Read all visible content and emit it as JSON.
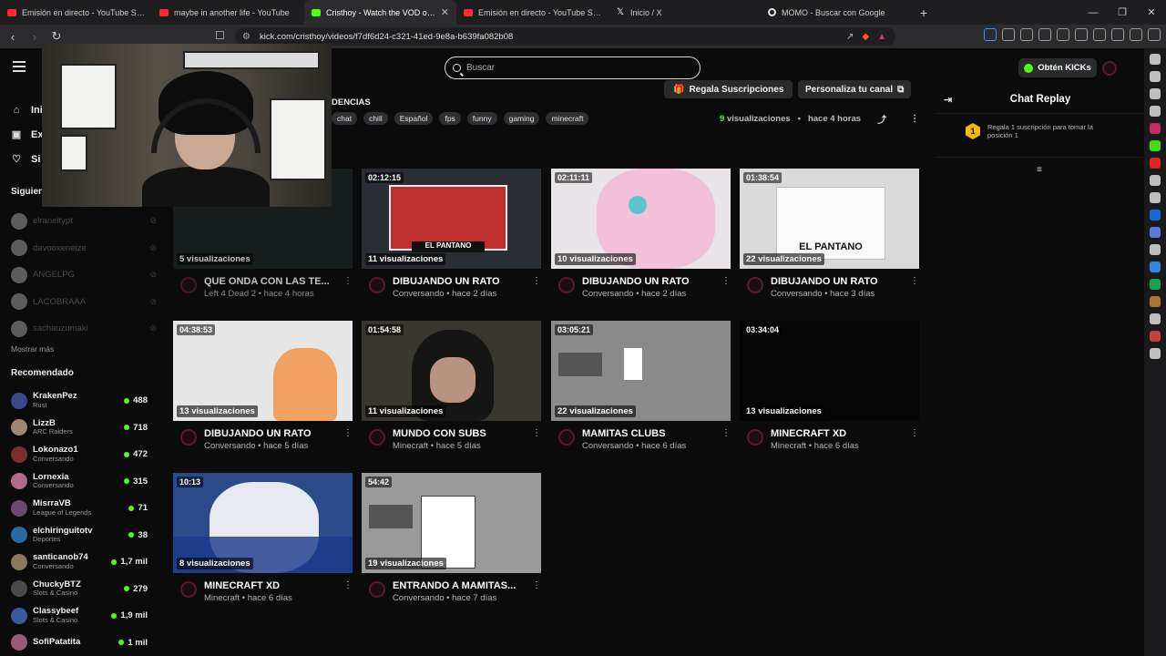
{
  "browser": {
    "tabs": [
      {
        "title": "Emisión en directo - YouTube Studio",
        "icon": "youtube-icon"
      },
      {
        "title": "maybe in another life - YouTube",
        "icon": "youtube-icon"
      },
      {
        "title": "Cristhoy - Watch the VOD on Kic",
        "icon": "kick-icon",
        "active": true
      },
      {
        "title": "Emisión en directo - YouTube Studio",
        "icon": "youtube-icon"
      },
      {
        "title": "Inicio / X",
        "icon": "x-icon"
      },
      {
        "title": "MOMO - Buscar con Google",
        "icon": "google-icon"
      }
    ],
    "url": "kick.com/cristhoy/videos/f7df6d24-c321-41ed-9e8a-b639fa082b08"
  },
  "sidebar": {
    "nav": [
      {
        "label": "Ini",
        "icon": "home-icon"
      },
      {
        "label": "Ex",
        "icon": "browse-icon"
      },
      {
        "label": "Si",
        "icon": "heart-icon"
      }
    ],
    "following_label": "Siguien",
    "following": [
      {
        "name": "elraneitypt"
      },
      {
        "name": "davooxeneize"
      },
      {
        "name": "ANGELPG"
      },
      {
        "name": "LACOBRAAA"
      },
      {
        "name": "sachauzumaki"
      }
    ],
    "show_more": "Mostrar más",
    "recommended_label": "Recomendado",
    "recommended": [
      {
        "name": "KrakenPez",
        "category": "Rust",
        "viewers": "488",
        "color": "#3b4a8a"
      },
      {
        "name": "LizzB",
        "category": "ARC Raiders",
        "viewers": "718",
        "color": "#a08770"
      },
      {
        "name": "Lokonazo1",
        "category": "Conversando",
        "viewers": "472",
        "color": "#7a2e2e"
      },
      {
        "name": "Lornexia",
        "category": "Conversando",
        "viewers": "315",
        "color": "#b06a8a"
      },
      {
        "name": "MisrraVB",
        "category": "League of Legends",
        "viewers": "71",
        "color": "#6a4a6a"
      },
      {
        "name": "elchiringuitotv",
        "category": "Deportes",
        "viewers": "38",
        "color": "#2a6aa0"
      },
      {
        "name": "santicanob74",
        "category": "Conversando",
        "viewers": "1,7 mil",
        "color": "#8a7a5a"
      },
      {
        "name": "ChuckyBTZ",
        "category": "Slots & Casino",
        "viewers": "279",
        "color": "#4a4a4a"
      },
      {
        "name": "Classybeef",
        "category": "Slots & Casino",
        "viewers": "1,9 mil",
        "color": "#3a5aa0"
      },
      {
        "name": "SofiPatatita",
        "category": "",
        "viewers": "1 mil",
        "color": "#9a5a7a"
      }
    ]
  },
  "header": {
    "search_placeholder": "Buscar",
    "kicks_label": "Obtén KICKs",
    "section_label": "DENCIAS",
    "gift_label": "Regala Suscripciones",
    "customize_label": "Personaliza tu canal",
    "tags": [
      "chat",
      "chill",
      "Español",
      "fps",
      "funny",
      "gaming",
      "minecraft"
    ],
    "views_count": "9",
    "views_label": "visualizaciones",
    "separator": "•",
    "ago": "hace 4 horas"
  },
  "videos": [
    {
      "duration": "",
      "views": "5 visualizaciones",
      "title": "QUE ONDA CON LAS TE...",
      "category": "Left 4 Dead 2",
      "ago": "hace 4 horas",
      "thumb": "#1c2422",
      "dim": true
    },
    {
      "duration": "02:12:15",
      "views": "11 visualizaciones",
      "title": "DIBUJANDO UN RATO",
      "category": "Conversando",
      "ago": "hace 2 días",
      "thumb": "#2a2d33"
    },
    {
      "duration": "02:11:11",
      "views": "10 visualizaciones",
      "title": "DIBUJANDO UN RATO",
      "category": "Conversando",
      "ago": "hace 2 días",
      "thumb": "#e8e4e8"
    },
    {
      "duration": "01:38:54",
      "views": "22 visualizaciones",
      "title": "DIBUJANDO UN RATO",
      "category": "Conversando",
      "ago": "hace 3 días",
      "thumb": "#d9d9d9"
    },
    {
      "duration": "04:38:53",
      "views": "13 visualizaciones",
      "title": "DIBUJANDO UN RATO",
      "category": "Conversando",
      "ago": "hace 5 días",
      "thumb": "#e6e6e6"
    },
    {
      "duration": "01:54:58",
      "views": "11 visualizaciones",
      "title": "MUNDO CON SUBS",
      "category": "Minecraft",
      "ago": "hace 5 días",
      "thumb": "#3a3630"
    },
    {
      "duration": "03:05:21",
      "views": "22 visualizaciones",
      "title": "MAMITAS CLUBS",
      "category": "Conversando",
      "ago": "hace 6 días",
      "thumb": "#8a8a8a"
    },
    {
      "duration": "03:34:04",
      "views": "13 visualizaciones",
      "title": "MINECRAFT XD",
      "category": "Minecraft",
      "ago": "hace 6 días",
      "thumb": "#050505"
    },
    {
      "duration": "10:13",
      "views": "8 visualizaciones",
      "title": "MINECRAFT XD",
      "category": "Minecraft",
      "ago": "hace 6 días",
      "thumb": "#2a4a8a"
    },
    {
      "duration": "54:42",
      "views": "19 visualizaciones",
      "title": "ENTRANDO A MAMITAS...",
      "category": "Conversando",
      "ago": "hace 7 días",
      "thumb": "#9a9a9a"
    }
  ],
  "chat": {
    "title": "Chat Replay",
    "goal_rank": "1",
    "goal_text": "Regala 1 suscripción para tomar la posición 1"
  },
  "colors": {
    "accent": "#53fc18",
    "background": "#0b0b0c"
  }
}
